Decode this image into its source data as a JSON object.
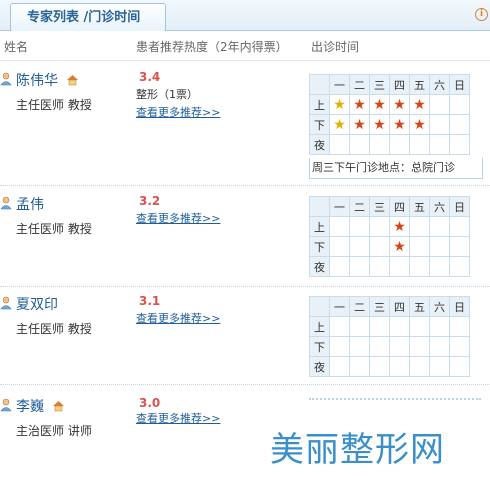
{
  "header": {
    "tab_label": "专家列表 /门诊时间",
    "info_icon": "i"
  },
  "columns": {
    "name": "姓名",
    "rating": "患者推荐热度（2年内得票）",
    "schedule": "出诊时间"
  },
  "days": [
    "一",
    "二",
    "三",
    "四",
    "五",
    "六",
    "日"
  ],
  "periods": [
    "上",
    "下",
    "夜"
  ],
  "doctors": [
    {
      "name": "陈伟华",
      "title": "主任医师 教授",
      "score": "3.4",
      "tag": "整形（1票）",
      "more": "查看更多推荐>>",
      "note": "周三下午门诊地点：总院门诊"
    },
    {
      "name": "孟伟",
      "title": "主任医师 教授",
      "score": "3.2",
      "more": "查看更多推荐>>"
    },
    {
      "name": "夏双印",
      "title": "主任医师 教授",
      "score": "3.1",
      "more": "查看更多推荐>>"
    },
    {
      "name": "李巍",
      "title": "主治医师 讲师",
      "score": "3.0",
      "more": "查看更多推荐>>"
    }
  ],
  "watermark": "美丽整形网",
  "colors": {
    "star_red": "#d84315",
    "star_yellow": "#e0b000",
    "link": "#1f5d98"
  }
}
